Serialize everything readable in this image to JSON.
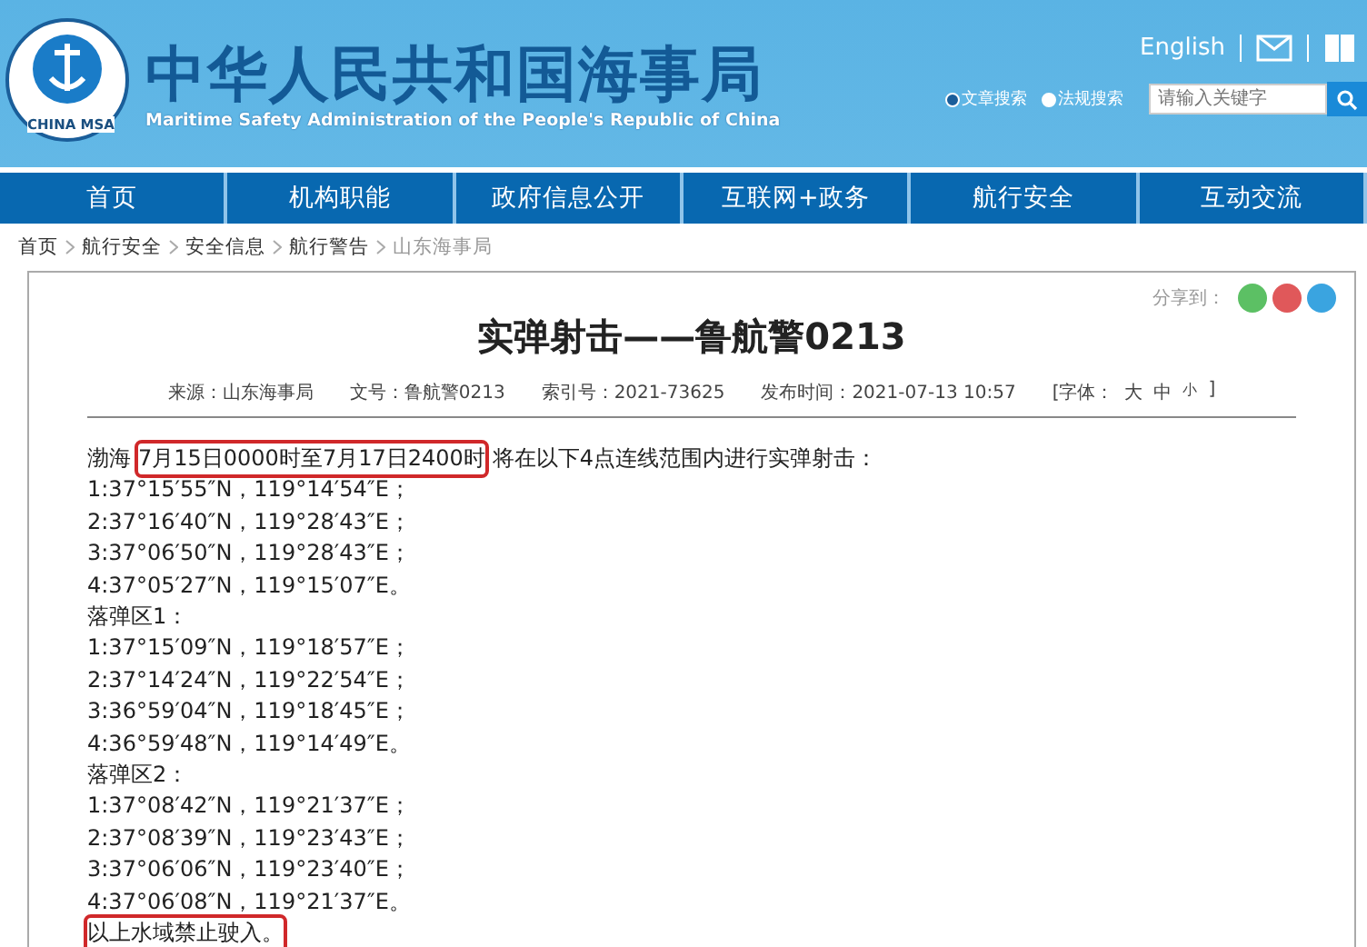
{
  "header": {
    "title": "中华人民共和国海事局",
    "subtitle": "Maritime Safety Administration of the People's Republic of China",
    "logo_text": "CHINA MSA",
    "english_link": "English",
    "search_options": [
      {
        "label": "文章搜索",
        "selected": true
      },
      {
        "label": "法规搜索",
        "selected": false
      }
    ],
    "search": {
      "placeholder": "请输入关键字"
    }
  },
  "nav": [
    "首页",
    "机构职能",
    "政府信息公开",
    "互联网+政务",
    "航行安全",
    "互动交流"
  ],
  "breadcrumb": [
    "首页",
    "航行安全",
    "安全信息",
    "航行警告",
    "山东海事局"
  ],
  "article": {
    "share_label": "分享到：",
    "share": [
      {
        "color": "#5cc064"
      },
      {
        "color": "#e0585a"
      },
      {
        "color": "#3aa4e0"
      }
    ],
    "title": "实弹射击——鲁航警0213",
    "meta": [
      "来源：山东海事局",
      "文号：鲁航警0213",
      "索引号：2021-73625",
      "发布时间：2021-07-13 10:57"
    ],
    "font_label": "[字体：",
    "font_sizes": [
      "大",
      "中",
      "小"
    ],
    "font_close": "]",
    "lines": [
      [
        {
          "text": "渤海",
          "highlighted": false
        },
        {
          "text": "7月15日0000时至7月17日2400时",
          "highlighted": true
        },
        {
          "text": "将在以下4点连线范围内进行实弹射击：",
          "highlighted": false
        }
      ],
      [
        {
          "text": "1:37°15′55″N，119°14′54″E；",
          "highlighted": false
        }
      ],
      [
        {
          "text": "2:37°16′40″N，119°28′43″E；",
          "highlighted": false
        }
      ],
      [
        {
          "text": "3:37°06′50″N，119°28′43″E；",
          "highlighted": false
        }
      ],
      [
        {
          "text": "4:37°05′27″N，119°15′07″E。",
          "highlighted": false
        }
      ],
      [
        {
          "text": "落弹区1：",
          "highlighted": false
        }
      ],
      [
        {
          "text": "1:37°15′09″N，119°18′57″E；",
          "highlighted": false
        }
      ],
      [
        {
          "text": "2:37°14′24″N，119°22′54″E；",
          "highlighted": false
        }
      ],
      [
        {
          "text": "3:36°59′04″N，119°18′45″E；",
          "highlighted": false
        }
      ],
      [
        {
          "text": "4:36°59′48″N，119°14′49″E。",
          "highlighted": false
        }
      ],
      [
        {
          "text": "落弹区2：",
          "highlighted": false
        }
      ],
      [
        {
          "text": "1:37°08′42″N，119°21′37″E；",
          "highlighted": false
        }
      ],
      [
        {
          "text": "2:37°08′39″N，119°23′43″E；",
          "highlighted": false
        }
      ],
      [
        {
          "text": "3:37°06′06″N，119°23′40″E；",
          "highlighted": false
        }
      ],
      [
        {
          "text": "4:37°06′08″N，119°21′37″E。",
          "highlighted": false
        }
      ],
      [
        {
          "text": "以上水域禁止驶入。",
          "highlighted": true
        }
      ]
    ]
  }
}
